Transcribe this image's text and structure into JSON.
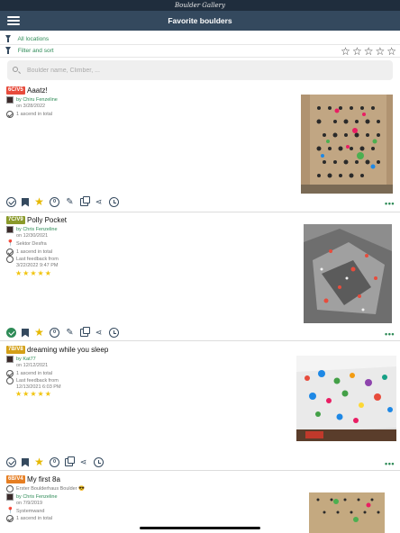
{
  "app": {
    "logo_text": "Boulder Gallery",
    "title": "Favorite boulders"
  },
  "filters": {
    "locations": "All locations",
    "filter_sort": "Filter and sort",
    "search_placeholder": "Boulder name, Climber, ..."
  },
  "boulders": [
    {
      "grade": "6C/V5",
      "grade_color": "#e74c3c",
      "name": "Aaatz!",
      "setter": "by Chiru Fenzeline",
      "date": "on 3/28/2022",
      "ascents": "1 ascend in total",
      "completed": false,
      "rating_stars": 0
    },
    {
      "grade": "7C/V9",
      "grade_color": "#8a9a2a",
      "name": "Polly Pocket",
      "setter": "by Chris Fenzeline",
      "date": "on 12/30/2021",
      "sector": "Sektor Desfra",
      "ascents": "1 ascend in total",
      "feedback_label": "Last feedback from",
      "feedback_date": "3/22/2022 9:47 PM",
      "rating_stars": 5,
      "completed": true
    },
    {
      "grade": "7B/V8",
      "grade_color": "#d4a017",
      "name": "dreaming while you sleep",
      "setter": "by Kat77",
      "date": "on 12/12/2021",
      "ascents": "1 ascend in total",
      "feedback_label": "Last feedback from",
      "feedback_date": "12/13/2021 6:03 PM",
      "rating_stars": 5,
      "completed": false
    },
    {
      "grade": "6B/V4",
      "grade_color": "#e67e22",
      "name": "My first 8a",
      "note": "Erster Boulderhaus Boulder 😎",
      "setter": "by Chris Fenzeline",
      "date": "on 7/9/2019",
      "sector": "Systemwand",
      "ascents": "1 ascend in total",
      "completed": false
    }
  ],
  "icons": {
    "menu": "hamburger-icon",
    "filter": "filter-icon",
    "search": "search-icon",
    "rating_filter": "star-outline-icon",
    "tick": "checkmark-circle-icon",
    "bookmark": "bookmark-icon",
    "favorite": "half-star-icon",
    "comment": "comment-icon",
    "edit": "pencil-icon",
    "copy": "copy-icon",
    "share": "share-icon",
    "history": "history-icon",
    "more": "more-dots-icon"
  },
  "ui": {
    "more_label": "•••",
    "comment_badge": "0"
  }
}
